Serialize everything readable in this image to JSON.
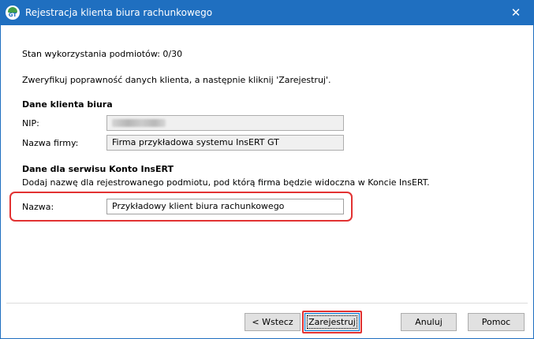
{
  "window": {
    "title": "Rejestracja klienta biura rachunkowego",
    "icon": "insert-gt-logo-icon",
    "close_glyph": "✕"
  },
  "content": {
    "usage_status": "Stan wykorzystania podmiotów: 0/30",
    "instruction": "Zweryfikuj poprawność danych klienta, a następnie kliknij 'Zarejestruj'.",
    "client_section": {
      "heading": "Dane klienta biura",
      "nip_label": "NIP:",
      "nip_value": "",
      "company_label": "Nazwa firmy:",
      "company_value": "Firma przykładowa systemu InsERT GT"
    },
    "service_section": {
      "heading": "Dane dla serwisu Konto InsERT",
      "description": "Dodaj nazwę dla rejestrowanego podmiotu, pod którą firma będzie widoczna w Koncie InsERT.",
      "name_label": "Nazwa:",
      "name_value": "Przykładowy klient biura rachunkowego"
    }
  },
  "buttons": {
    "back": "< Wstecz",
    "register": "Zarejestruj",
    "cancel": "Anuluj",
    "help": "Pomoc"
  },
  "colors": {
    "titlebar": "#1f6fc0",
    "highlight": "#e23232",
    "focus_border": "#0078d7"
  }
}
